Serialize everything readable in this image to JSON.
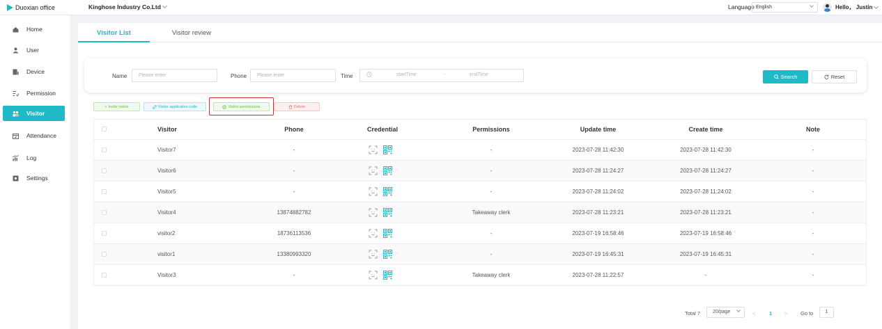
{
  "app": {
    "logo_text": "Duoxian office"
  },
  "header": {
    "company": "Kinghose Industry Co.Ltd",
    "language_label": "Language",
    "language_value": "English",
    "greeting": "Hello， Justin"
  },
  "sidebar": {
    "items": [
      {
        "label": "Home",
        "icon": "home-icon"
      },
      {
        "label": "User",
        "icon": "user-icon"
      },
      {
        "label": "Device",
        "icon": "device-icon"
      },
      {
        "label": "Permission",
        "icon": "permission-icon"
      },
      {
        "label": "Visitor",
        "icon": "visitor-icon",
        "active": true
      },
      {
        "label": "Attendance",
        "icon": "calendar-icon"
      },
      {
        "label": "Log",
        "icon": "log-icon"
      },
      {
        "label": "Settings",
        "icon": "settings-icon"
      }
    ]
  },
  "tabs": [
    {
      "label": "Visitor List",
      "active": true
    },
    {
      "label": "Visitor review",
      "active": false
    }
  ],
  "filters": {
    "name_label": "Name",
    "name_placeholder": "Please enter",
    "phone_label": "Phone",
    "phone_placeholder": "Please enter",
    "time_label": "Time",
    "start_placeholder": "startTime",
    "range_separator": "-",
    "end_placeholder": "endTime",
    "search_label": "Search",
    "reset_label": "Reset"
  },
  "actions": {
    "invite": "Invite visitor",
    "application_code": "Visitor application code",
    "permissions": "Visitor permissions",
    "delete": "Delete"
  },
  "table": {
    "columns": [
      "Visitor",
      "Phone",
      "Credential",
      "Permissions",
      "Update time",
      "Create time",
      "Note"
    ],
    "rows": [
      {
        "visitor": "Visitor7",
        "phone": "-",
        "permissions": "-",
        "update_time": "2023-07-28 11:42:30",
        "create_time": "2023-07-28 11:42:30",
        "note": "-"
      },
      {
        "visitor": "Visitor6",
        "phone": "-",
        "permissions": "-",
        "update_time": "2023-07-28 11:24:27",
        "create_time": "2023-07-28 11:24:27",
        "note": "-"
      },
      {
        "visitor": "Visitor5",
        "phone": "-",
        "permissions": "-",
        "update_time": "2023-07-28 11:24:02",
        "create_time": "2023-07-28 11:24:02",
        "note": "-"
      },
      {
        "visitor": "Visitor4",
        "phone": "13874882782",
        "permissions": "Takeaway clerk",
        "update_time": "2023-07-28 11:23:21",
        "create_time": "2023-07-28 11:23:21",
        "note": "-"
      },
      {
        "visitor": "visitor2",
        "phone": "18736113536",
        "permissions": "-",
        "update_time": "2023-07-19 16:58:46",
        "create_time": "2023-07-19 16:58:46",
        "note": "-"
      },
      {
        "visitor": "visitor1",
        "phone": "13380993320",
        "permissions": "-",
        "update_time": "2023-07-19 16:45:31",
        "create_time": "2023-07-19 16:45:31",
        "note": "-"
      },
      {
        "visitor": "Visitor3",
        "phone": "-",
        "permissions": "Takeaway clerk",
        "update_time": "2023-07-28 11:22:57",
        "create_time": "-",
        "note": "-"
      }
    ]
  },
  "pagination": {
    "total": "Total 7",
    "page_size": "20/page",
    "prev": "<",
    "current": "1",
    "next": ">",
    "goto_label": "Go to",
    "goto_value": "1"
  },
  "colors": {
    "accent": "#1fb9c8",
    "success": "#67c23a",
    "danger": "#f56c6c",
    "highlight": "#d23030"
  }
}
